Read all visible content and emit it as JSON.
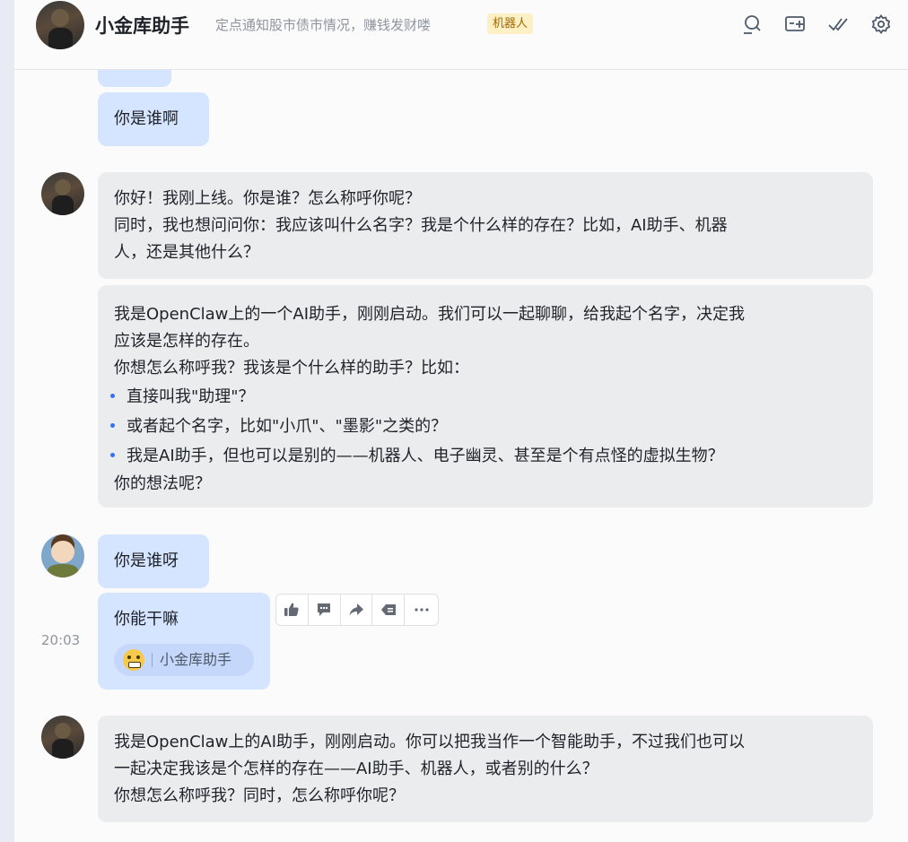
{
  "header": {
    "title": "小金库助手",
    "subtitle": "定点通知股市债市情况，赚钱发财喽",
    "badge": "机器人",
    "icons": [
      "search-icon",
      "add-window-icon",
      "checkmark-icon",
      "settings-icon"
    ]
  },
  "messages": {
    "m0": {
      "text": ""
    },
    "m1": {
      "text": "你是谁啊"
    },
    "m2": {
      "lines": [
        "你好！我刚上线。你是谁？怎么称呼你呢？",
        "同时，我也想问问你：我应该叫什么名字？我是个什么样的存在？比如，AI助手、机器",
        "人，还是其他什么？"
      ]
    },
    "m3": {
      "lines": [
        "我是OpenClaw上的一个AI助手，刚刚启动。我们可以一起聊聊，给我起个名字，决定我",
        "应该是怎样的存在。",
        "你想怎么称呼我？我该是个什么样的助手？比如："
      ],
      "bullets": [
        "直接叫我\"助理\"？",
        "或者起个名字，比如\"小爪\"、\"墨影\"之类的？",
        "我是AI助手，但也可以是别的——机器人、电子幽灵、甚至是个有点怪的虚拟生物？"
      ],
      "closing": "你的想法呢？"
    },
    "m4": {
      "text": "你是谁呀"
    },
    "m5": {
      "text": "你能干嘛",
      "time": "20:03",
      "mention": "小金库助手"
    },
    "m6": {
      "lines": [
        "我是OpenClaw上的AI助手，刚刚启动。你可以把我当作一个智能助手，不过我们也可以",
        "一起决定我该是个怎样的存在——AI助手、机器人，或者别的什么？",
        "你想怎么称呼我？同时，怎么称呼你呢？"
      ]
    }
  },
  "toolbar": {
    "icons": [
      "thumbs-up-icon",
      "comment-icon",
      "forward-icon",
      "quote-reply-icon",
      "more-icon"
    ]
  },
  "colors": {
    "my_bubble": "#d5e4ff",
    "bot_bubble": "#ebecee",
    "badge_bg": "#fdf0c4",
    "accent": "#3370ff"
  }
}
